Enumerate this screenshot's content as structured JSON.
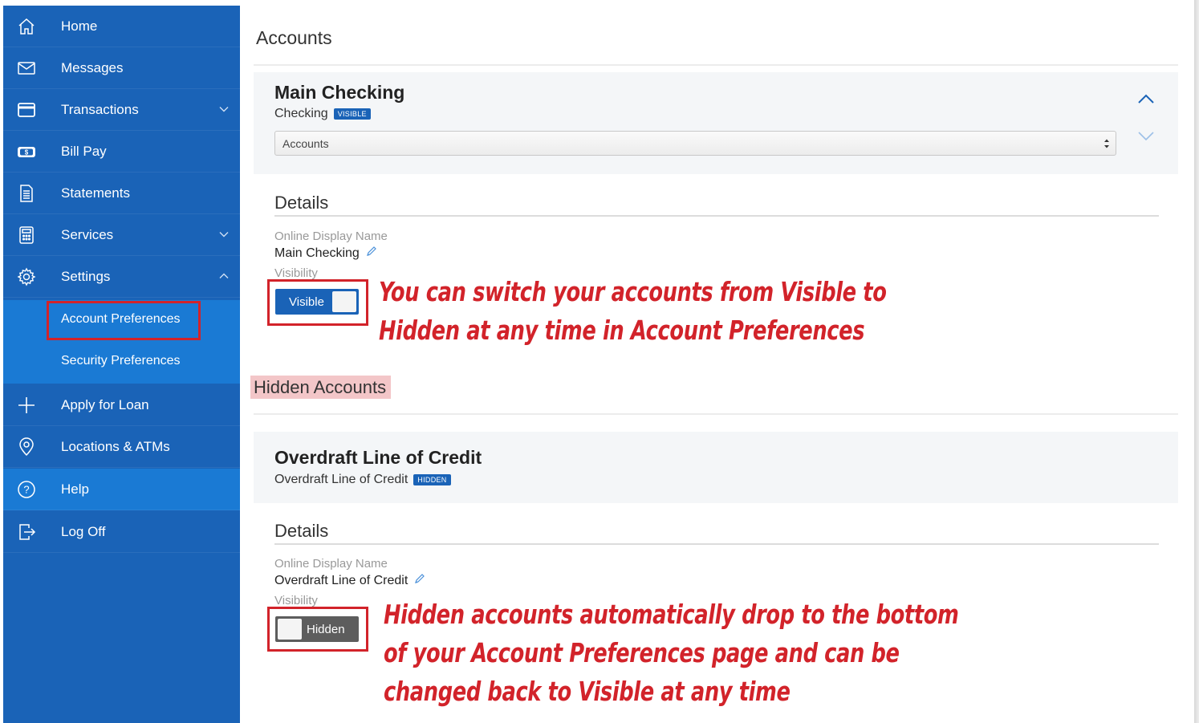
{
  "sidebar": {
    "items": [
      {
        "label": "Home",
        "icon": "home-icon"
      },
      {
        "label": "Messages",
        "icon": "envelope-icon"
      },
      {
        "label": "Transactions",
        "icon": "card-icon"
      },
      {
        "label": "Bill Pay",
        "icon": "bill-icon"
      },
      {
        "label": "Statements",
        "icon": "document-icon"
      },
      {
        "label": "Services",
        "icon": "calculator-icon"
      },
      {
        "label": "Settings",
        "icon": "gear-icon"
      },
      {
        "label": "Apply for Loan",
        "icon": "plus-icon"
      },
      {
        "label": "Locations & ATMs",
        "icon": "location-pin-icon"
      },
      {
        "label": "Help",
        "icon": "help-icon"
      },
      {
        "label": "Log Off",
        "icon": "logout-icon"
      }
    ],
    "submenu": [
      {
        "label": "Account Preferences"
      },
      {
        "label": "Security Preferences"
      }
    ],
    "colors": {
      "background": "#1a63b7",
      "submenu": "#1a7ad4"
    }
  },
  "main": {
    "title": "Accounts",
    "account1": {
      "name": "Main Checking",
      "type": "Checking",
      "badge": "VISIBLE",
      "select_value": "Accounts",
      "details_title": "Details",
      "display_name_label": "Online Display Name",
      "display_name_value": "Main Checking",
      "visibility_label": "Visibility",
      "toggle_label": "Visible"
    },
    "hidden_section_title": "Hidden Accounts",
    "account2": {
      "name": "Overdraft Line of Credit",
      "type": "Overdraft Line of Credit",
      "badge": "HIDDEN",
      "details_title": "Details",
      "display_name_label": "Online Display Name",
      "display_name_value": "Overdraft Line of Credit",
      "visibility_label": "Visibility",
      "toggle_label": "Hidden"
    }
  },
  "annotations": {
    "note1": [
      "You can switch your accounts from Visible to",
      "Hidden at any time in Account Preferences"
    ],
    "note2": [
      "Hidden accounts automatically drop to the bottom",
      "of your Account Preferences page and can be",
      "changed back to Visible at any time"
    ],
    "color": "#d2232a"
  }
}
